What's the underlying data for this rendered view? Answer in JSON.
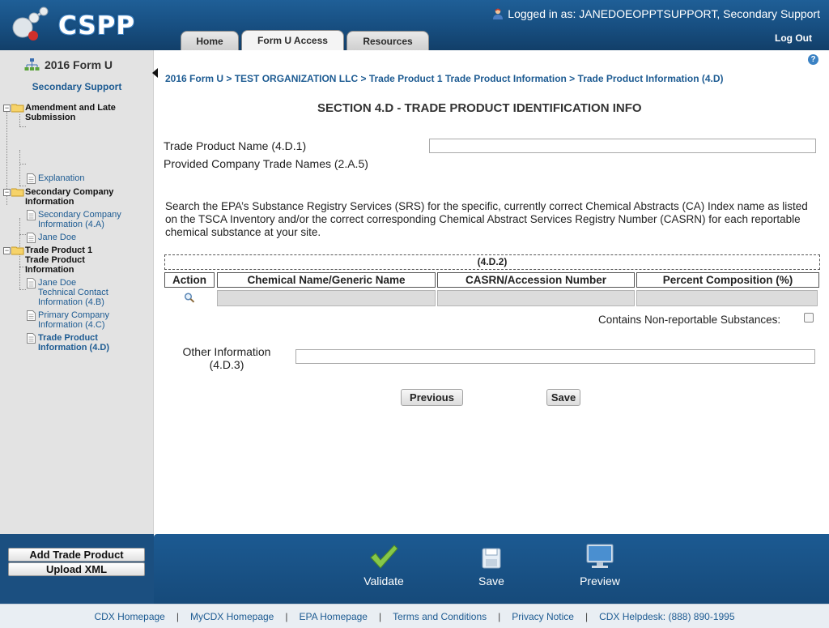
{
  "app": {
    "name": "CSPP"
  },
  "header": {
    "login_text": "Logged in as: JANEDOEOPPTSUPPORT, Secondary Support",
    "logout": "Log Out",
    "tabs": [
      {
        "label": "Home",
        "active": false
      },
      {
        "label": "Form U Access",
        "active": true
      },
      {
        "label": "Resources",
        "active": false
      }
    ]
  },
  "sidebar": {
    "title": "2016 Form U",
    "subtitle": "Secondary Support",
    "tree": [
      {
        "label_lines": [
          "Amendment and Late",
          "Submission"
        ],
        "type": "folder"
      },
      {
        "label_lines": [
          "Explanation"
        ],
        "type": "leaf"
      },
      {
        "label_lines": [
          "Secondary Company",
          "Information"
        ],
        "type": "folder"
      },
      {
        "label_lines": [
          "Secondary Company",
          "Information (4.A)"
        ],
        "type": "leaf"
      },
      {
        "label_lines": [
          "Jane Doe"
        ],
        "type": "leaf"
      },
      {
        "label_lines": [
          "Trade Product 1",
          "Trade Product",
          "Information"
        ],
        "type": "folder"
      },
      {
        "label_lines": [
          "Jane Doe",
          "Technical Contact",
          "Information (4.B)"
        ],
        "type": "leaf"
      },
      {
        "label_lines": [
          "Primary Company",
          "Information (4.C)"
        ],
        "type": "leaf"
      },
      {
        "label_lines": [
          "Trade Product",
          "Information (4.D)"
        ],
        "type": "leaf",
        "current": true
      }
    ],
    "buttons": {
      "add_trade_product": "Add Trade Product",
      "upload_xml": "Upload XML"
    }
  },
  "main": {
    "breadcrumb": "2016 Form U > TEST ORGANIZATION LLC > Trade Product 1 Trade Product Information > Trade Product Information (4.D)",
    "section_title": "SECTION 4.D - TRADE PRODUCT IDENTIFICATION INFO",
    "trade_product_name_label": "Trade Product Name (4.D.1)",
    "trade_product_name_value": "",
    "provided_names_label": "Provided Company Trade Names (2.A.5)",
    "description": "Search the EPA’s Substance Registry Services (SRS) for the specific, currently correct Chemical Abstracts (CA) Index name as listed on the TSCA Inventory and/or the correct corresponding Chemical Abstract Services Registry Number (CASRN) for each reportable chemical substance at your site.",
    "grid": {
      "caption": "(4.D.2)",
      "columns": [
        "Action",
        "Chemical Name/Generic Name",
        "CASRN/Accession Number",
        "Percent Composition (%)"
      ]
    },
    "non_reportable_label": "Contains Non-reportable Substances:",
    "other_info_label_lines": [
      "Other Information",
      "(4.D.3)"
    ],
    "other_info_value": "",
    "buttons": {
      "previous": "Previous",
      "save": "Save"
    }
  },
  "actions": [
    {
      "label": "Validate",
      "icon": "checkmark-icon"
    },
    {
      "label": "Save",
      "icon": "floppy-disk-icon"
    },
    {
      "label": "Preview",
      "icon": "monitor-icon"
    }
  ],
  "footer": {
    "links": [
      "CDX Homepage",
      "MyCDX Homepage",
      "EPA Homepage",
      "Terms and Conditions",
      "Privacy Notice",
      "CDX Helpdesk: (888) 890-1995"
    ]
  },
  "colors": {
    "header_blue": "#1f5f97",
    "link_blue": "#1d5b92",
    "sidebar_gray": "#e3e3e3",
    "check_green": "#7cc242"
  }
}
